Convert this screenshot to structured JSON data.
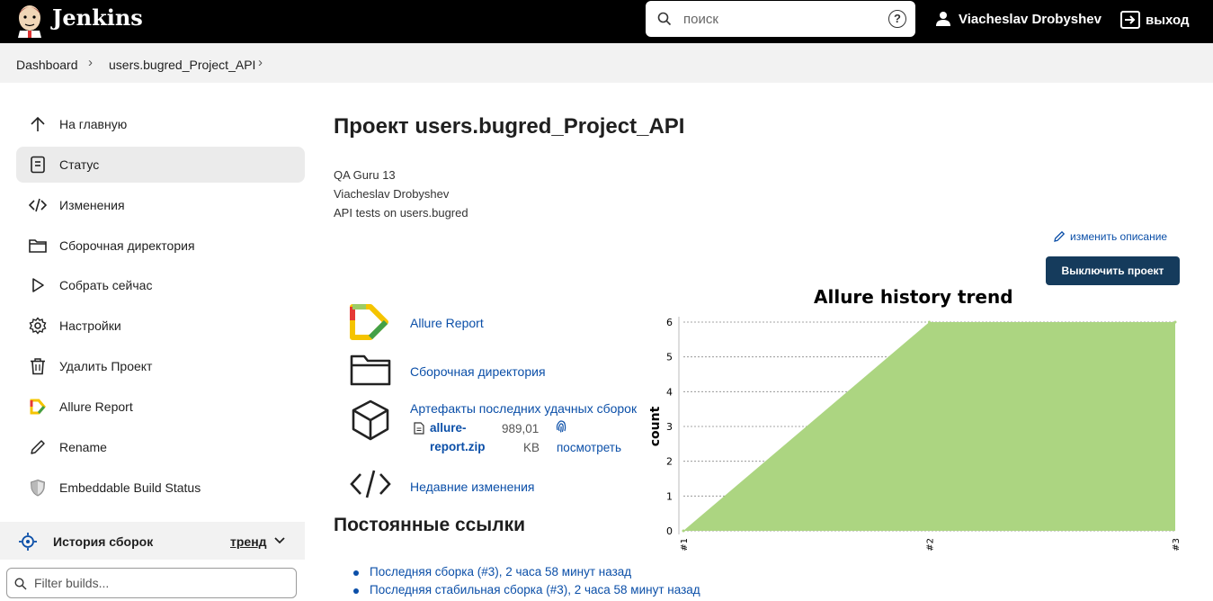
{
  "header": {
    "brand": "Jenkins",
    "search_placeholder": "поиск",
    "help": "?",
    "user": "Viacheslav Drobyshev",
    "logout": "выход"
  },
  "breadcrumb": [
    "Dashboard",
    "users.bugred_Project_API"
  ],
  "sidebar": {
    "items": [
      {
        "label": "На главную",
        "icon": "arrow-up-icon"
      },
      {
        "label": "Статус",
        "icon": "document-icon"
      },
      {
        "label": "Изменения",
        "icon": "code-icon"
      },
      {
        "label": "Сборочная директория",
        "icon": "folder-icon"
      },
      {
        "label": "Собрать сейчас",
        "icon": "play-icon"
      },
      {
        "label": "Настройки",
        "icon": "gear-icon"
      },
      {
        "label": "Удалить Проект",
        "icon": "trash-icon"
      },
      {
        "label": "Allure Report",
        "icon": "allure-icon"
      },
      {
        "label": "Rename",
        "icon": "pencil-icon"
      },
      {
        "label": "Embeddable Build Status",
        "icon": "shield-icon"
      }
    ],
    "history_label": "История сборок",
    "trend_label": "тренд",
    "filter_placeholder": "Filter builds..."
  },
  "main": {
    "title": "Проект users.bugred_Project_API",
    "description": [
      "QA Guru 13",
      "Viacheslav Drobyshev",
      "API tests on users.bugred"
    ],
    "edit_description": "изменить описание",
    "disable_button": "Выключить проект",
    "links": {
      "allure": "Allure Report",
      "workspace": "Сборочная директория",
      "artifacts": "Артефакты последних удачных сборок",
      "artifact_name_1": "allure-",
      "artifact_name_2": "report.zip",
      "artifact_size_1": "989,01",
      "artifact_size_2": "KB",
      "artifact_view": "посмотреть",
      "changes": "Недавние изменения"
    },
    "permalinks_title": "Постоянные ссылки",
    "permalinks": [
      "Последняя сборка (#3), 2 часа 58 минут назад",
      "Последняя стабильная сборка (#3), 2 часа 58 минут назад"
    ]
  },
  "colors": {
    "header_bg": "#000000",
    "link": "#0b4fa8",
    "button_bg": "#153b5c",
    "chart_fill": "#acd581"
  },
  "chart_data": {
    "type": "area",
    "title": "Allure history trend",
    "xlabel": "",
    "ylabel": "count",
    "categories": [
      "#1",
      "#2",
      "#3"
    ],
    "series": [
      {
        "values": [
          0,
          6,
          6
        ]
      }
    ],
    "ylim": [
      0,
      6
    ],
    "yticks": [
      0,
      1,
      2,
      3,
      4,
      5,
      6
    ],
    "grid": true
  }
}
